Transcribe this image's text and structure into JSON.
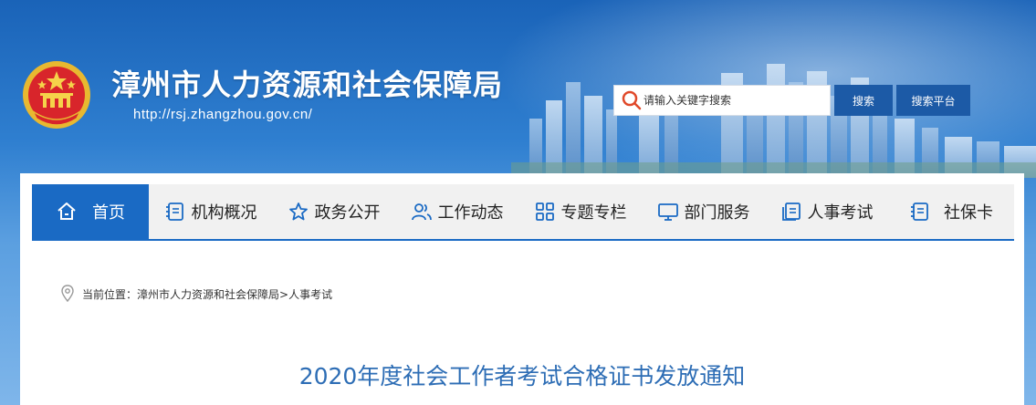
{
  "header": {
    "site_title": "漳州市人力资源和社会保障局",
    "site_url": "http://rsj.zhangzhou.gov.cn/",
    "emblem_icon": "national-emblem-icon"
  },
  "search": {
    "placeholder": "请输入关键字搜索",
    "search_button": "搜索",
    "platform_button": "搜索平台"
  },
  "nav": {
    "items": [
      {
        "label": "首页",
        "icon": "home-icon",
        "active": true
      },
      {
        "label": "机构概况",
        "icon": "document-list-icon",
        "active": false
      },
      {
        "label": "政务公开",
        "icon": "star-icon",
        "active": false
      },
      {
        "label": "工作动态",
        "icon": "users-icon",
        "active": false
      },
      {
        "label": "专题专栏",
        "icon": "grid-icon",
        "active": false
      },
      {
        "label": "部门服务",
        "icon": "monitor-icon",
        "active": false
      },
      {
        "label": "人事考试",
        "icon": "file-icon",
        "active": false
      },
      {
        "label": "社保卡",
        "icon": "document-list-icon",
        "active": false
      }
    ]
  },
  "breadcrumb": {
    "prefix": "当前位置：",
    "level1": "漳州市人力资源和社会保障局",
    "separator": ">",
    "level2": "人事考试"
  },
  "article": {
    "title": "2020年度社会工作者考试合格证书发放通知"
  },
  "colors": {
    "brand_blue": "#1a6ac4",
    "button_blue": "#1c5aa6",
    "title_blue": "#2d6db5",
    "search_icon_red": "#e0492a"
  }
}
